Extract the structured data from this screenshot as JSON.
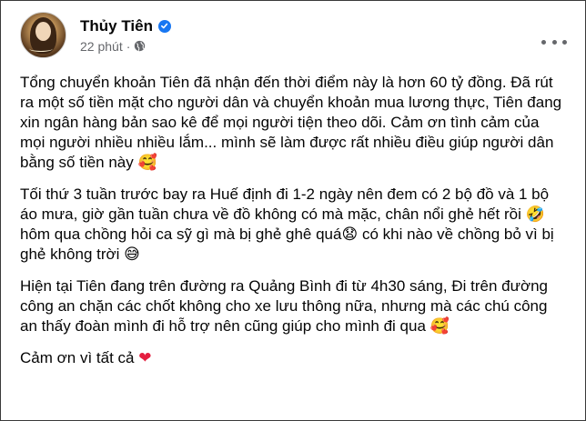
{
  "post": {
    "author": "Thủy Tiên",
    "time": "22 phút",
    "separator": "·",
    "paragraphs": [
      {
        "text": "Tổng chuyển khoản Tiên đã nhận đến thời điểm này là hơn 60 tỷ đồng. Đã rút ra một số tiền mặt cho người dân và chuyển khoản mua lương thực, Tiên đang xin ngân hàng bản sao kê để mọi người tiện theo dõi. Cảm ơn tình cảm của mọi người nhiều nhiều lắm... mình sẽ làm được rất nhiều điều giúp người dân bằng số tiền này",
        "emoji": "🥰"
      },
      {
        "text1": "Tối thứ 3 tuần trước bay ra Huế định đi 1-2 ngày nên đem có 2 bộ đồ và 1 bộ áo mưa, giờ gần tuần chưa về đồ không có mà mặc, chân nổi ghẻ hết rồi",
        "emoji1": "🤣",
        "text2": "hôm qua chồng hỏi ca sỹ gì mà bị ghẻ ghê quá",
        "emoji2": "😧",
        "text3": "có khi nào về chồng bỏ vì bị ghẻ không trời",
        "emoji3": "😅"
      },
      {
        "text": "Hiện tại Tiên đang trên đường ra Quảng Bình đi từ 4h30 sáng, Đi trên đường công an chặn các chốt không cho xe lưu thông nữa, nhưng mà các chú công an thấy đoàn mình đi hỗ trợ nên cũng giúp cho mình đi qua",
        "emoji": "🥰"
      },
      {
        "text": "Cảm ơn vì tất cả",
        "emoji": "❤"
      }
    ]
  },
  "icons": {
    "verified": "verified-badge-icon",
    "audience": "globe-icon",
    "more": "more-options-icon"
  },
  "colors": {
    "verified_blue": "#1877f2",
    "meta_gray": "#65676b",
    "heart_red": "#e41e3f"
  }
}
